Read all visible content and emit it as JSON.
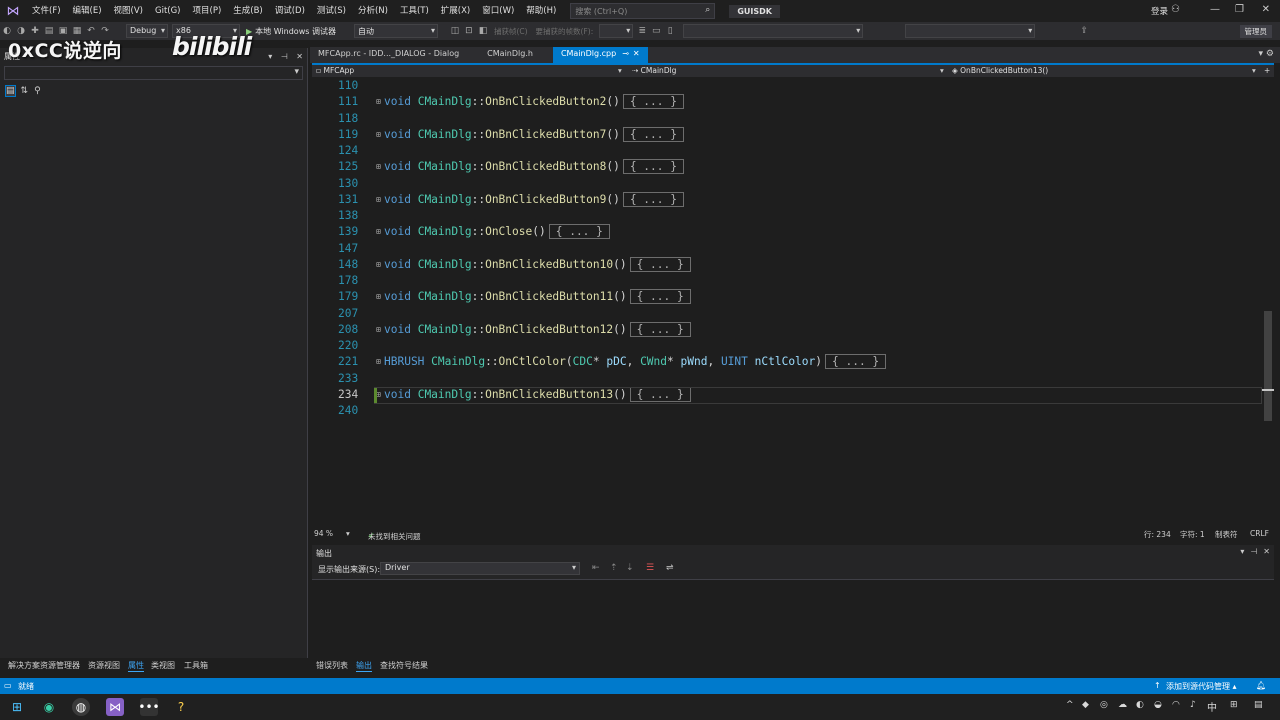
{
  "menubar": {
    "items": [
      "文件(F)",
      "编辑(E)",
      "视图(V)",
      "Git(G)",
      "项目(P)",
      "生成(B)",
      "调试(D)",
      "测试(S)",
      "分析(N)",
      "工具(T)",
      "扩展(X)",
      "窗口(W)",
      "帮助(H)"
    ],
    "search_placeholder": "搜索 (Ctrl+Q)",
    "solution_name": "GUISDK",
    "login": "登录"
  },
  "toolbar": {
    "config": "Debug",
    "platform": "x86",
    "run_label": "本地 Windows 调试器",
    "auto_label": "自动",
    "faded_1": "捕获帧(C)",
    "faded_2": "要捕获的帧数(F):",
    "share_label": "管理员"
  },
  "watermark": {
    "text": "0xCC说逆向",
    "logo": "bilibili"
  },
  "properties_panel": {
    "title": "属性"
  },
  "doc_tabs": [
    {
      "label": "MFCApp.rc - IDD..._DIALOG - Dialog",
      "active": false
    },
    {
      "label": "CMainDlg.h",
      "active": false
    },
    {
      "label": "CMainDlg.cpp",
      "active": true
    }
  ],
  "navbar": {
    "project": "MFCApp",
    "scope": "CMainDlg",
    "member": "OnBnClickedButton13()"
  },
  "editor": {
    "collapsed_text": "{ ... }",
    "lines": [
      {
        "num": "110",
        "ret": "",
        "cls": "",
        "fn": "",
        "params": ""
      },
      {
        "num": "111",
        "ret": "void",
        "cls": "CMainDlg",
        "fn": "OnBnClickedButton2",
        "params": ""
      },
      {
        "num": "118",
        "ret": "",
        "cls": "",
        "fn": "",
        "params": ""
      },
      {
        "num": "119",
        "ret": "void",
        "cls": "CMainDlg",
        "fn": "OnBnClickedButton7",
        "params": ""
      },
      {
        "num": "124",
        "ret": "",
        "cls": "",
        "fn": "",
        "params": ""
      },
      {
        "num": "125",
        "ret": "void",
        "cls": "CMainDlg",
        "fn": "OnBnClickedButton8",
        "params": ""
      },
      {
        "num": "130",
        "ret": "",
        "cls": "",
        "fn": "",
        "params": ""
      },
      {
        "num": "131",
        "ret": "void",
        "cls": "CMainDlg",
        "fn": "OnBnClickedButton9",
        "params": ""
      },
      {
        "num": "138",
        "ret": "",
        "cls": "",
        "fn": "",
        "params": ""
      },
      {
        "num": "139",
        "ret": "void",
        "cls": "CMainDlg",
        "fn": "OnClose",
        "params": ""
      },
      {
        "num": "147",
        "ret": "",
        "cls": "",
        "fn": "",
        "params": ""
      },
      {
        "num": "148",
        "ret": "void",
        "cls": "CMainDlg",
        "fn": "OnBnClickedButton10",
        "params": ""
      },
      {
        "num": "178",
        "ret": "",
        "cls": "",
        "fn": "",
        "params": ""
      },
      {
        "num": "179",
        "ret": "void",
        "cls": "CMainDlg",
        "fn": "OnBnClickedButton11",
        "params": ""
      },
      {
        "num": "207",
        "ret": "",
        "cls": "",
        "fn": "",
        "params": ""
      },
      {
        "num": "208",
        "ret": "void",
        "cls": "CMainDlg",
        "fn": "OnBnClickedButton12",
        "params": ""
      },
      {
        "num": "220",
        "ret": "",
        "cls": "",
        "fn": "",
        "params": ""
      },
      {
        "num": "221",
        "ret": "HBRUSH",
        "cls": "CMainDlg",
        "fn": "OnCtlColor",
        "params": "CDC* pDC, CWnd* pWnd, UINT nCtlColor"
      },
      {
        "num": "233",
        "ret": "",
        "cls": "",
        "fn": "",
        "params": ""
      },
      {
        "num": "234",
        "ret": "void",
        "cls": "CMainDlg",
        "fn": "OnBnClickedButton13",
        "params": ""
      },
      {
        "num": "240",
        "ret": "",
        "cls": "",
        "fn": "",
        "params": ""
      }
    ]
  },
  "editor_status": {
    "zoom": "94 %",
    "issues": "未找到相关问题",
    "line": "行: 234",
    "char": "字符: 1",
    "indent": "制表符",
    "eol": "CRLF"
  },
  "output": {
    "title": "输出",
    "source_label": "显示输出来源(S):",
    "source_value": "Driver"
  },
  "bottom_tabs_left": [
    "解决方案资源管理器",
    "资源视图",
    "属性",
    "类视图",
    "工具箱"
  ],
  "bottom_tabs_right": [
    "错误列表",
    "输出",
    "查找符号结果"
  ],
  "statusbar": {
    "ready": "就绪",
    "source_control": "添加到源代码管理 ▴"
  },
  "colors": {
    "accent": "#007acc",
    "keyword": "#569cd6",
    "class": "#4ec9b0",
    "function": "#dcdcaa",
    "param": "#9cdcfe",
    "line_number": "#2b91af"
  }
}
